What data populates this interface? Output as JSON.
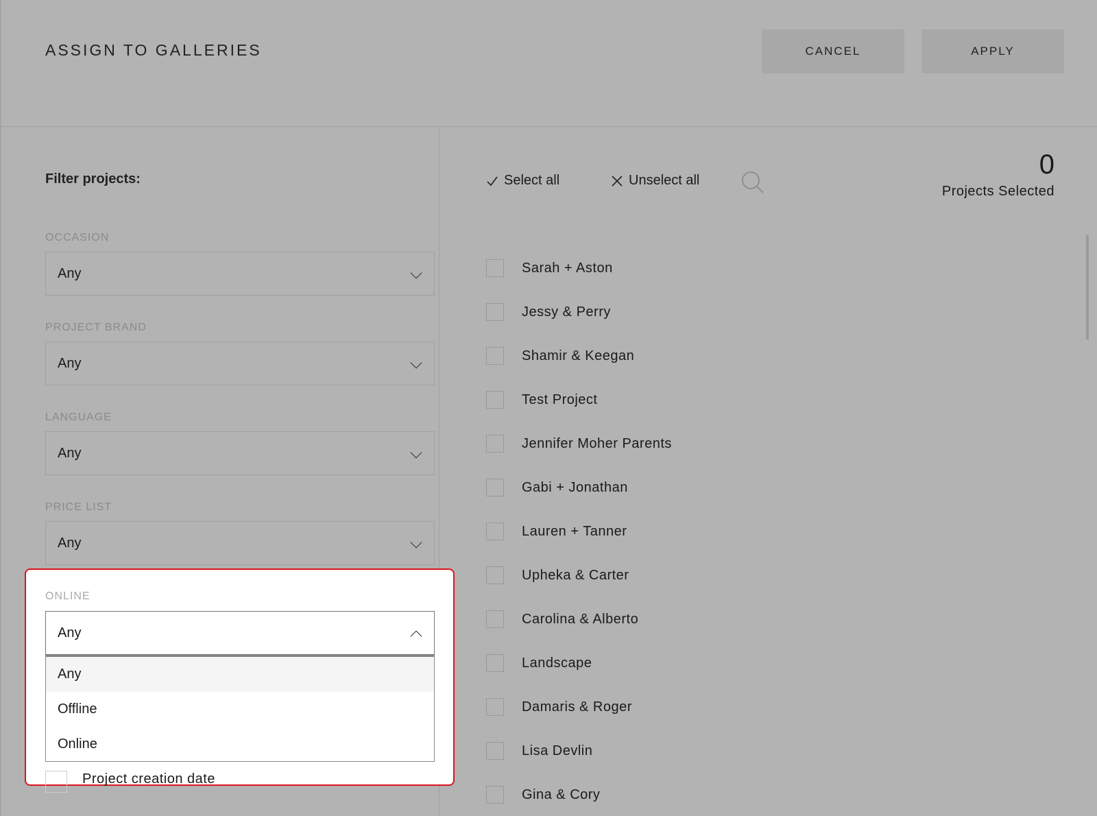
{
  "header": {
    "title": "ASSIGN TO GALLERIES",
    "cancel": "CANCEL",
    "apply": "APPLY"
  },
  "filters": {
    "title": "Filter projects:",
    "groups": [
      {
        "label": "OCCASION",
        "value": "Any"
      },
      {
        "label": "PROJECT BRAND",
        "value": "Any"
      },
      {
        "label": "LANGUAGE",
        "value": "Any"
      },
      {
        "label": "PRICE LIST",
        "value": "Any"
      }
    ],
    "online": {
      "label": "ONLINE",
      "value": "Any",
      "options": [
        "Any",
        "Offline",
        "Online"
      ]
    },
    "creation_date": "Project creation date"
  },
  "toolbar": {
    "select_all": "Select all",
    "unselect_all": "Unselect all",
    "count": "0",
    "count_label": "Projects Selected"
  },
  "projects": [
    "Sarah + Aston",
    "Jessy & Perry",
    "Shamir & Keegan",
    "Test Project",
    "Jennifer Moher Parents",
    "Gabi + Jonathan",
    "Lauren + Tanner",
    "Upheka & Carter",
    "Carolina & Alberto",
    "Landscape",
    "Damaris & Roger",
    "Lisa Devlin",
    "Gina & Cory"
  ]
}
